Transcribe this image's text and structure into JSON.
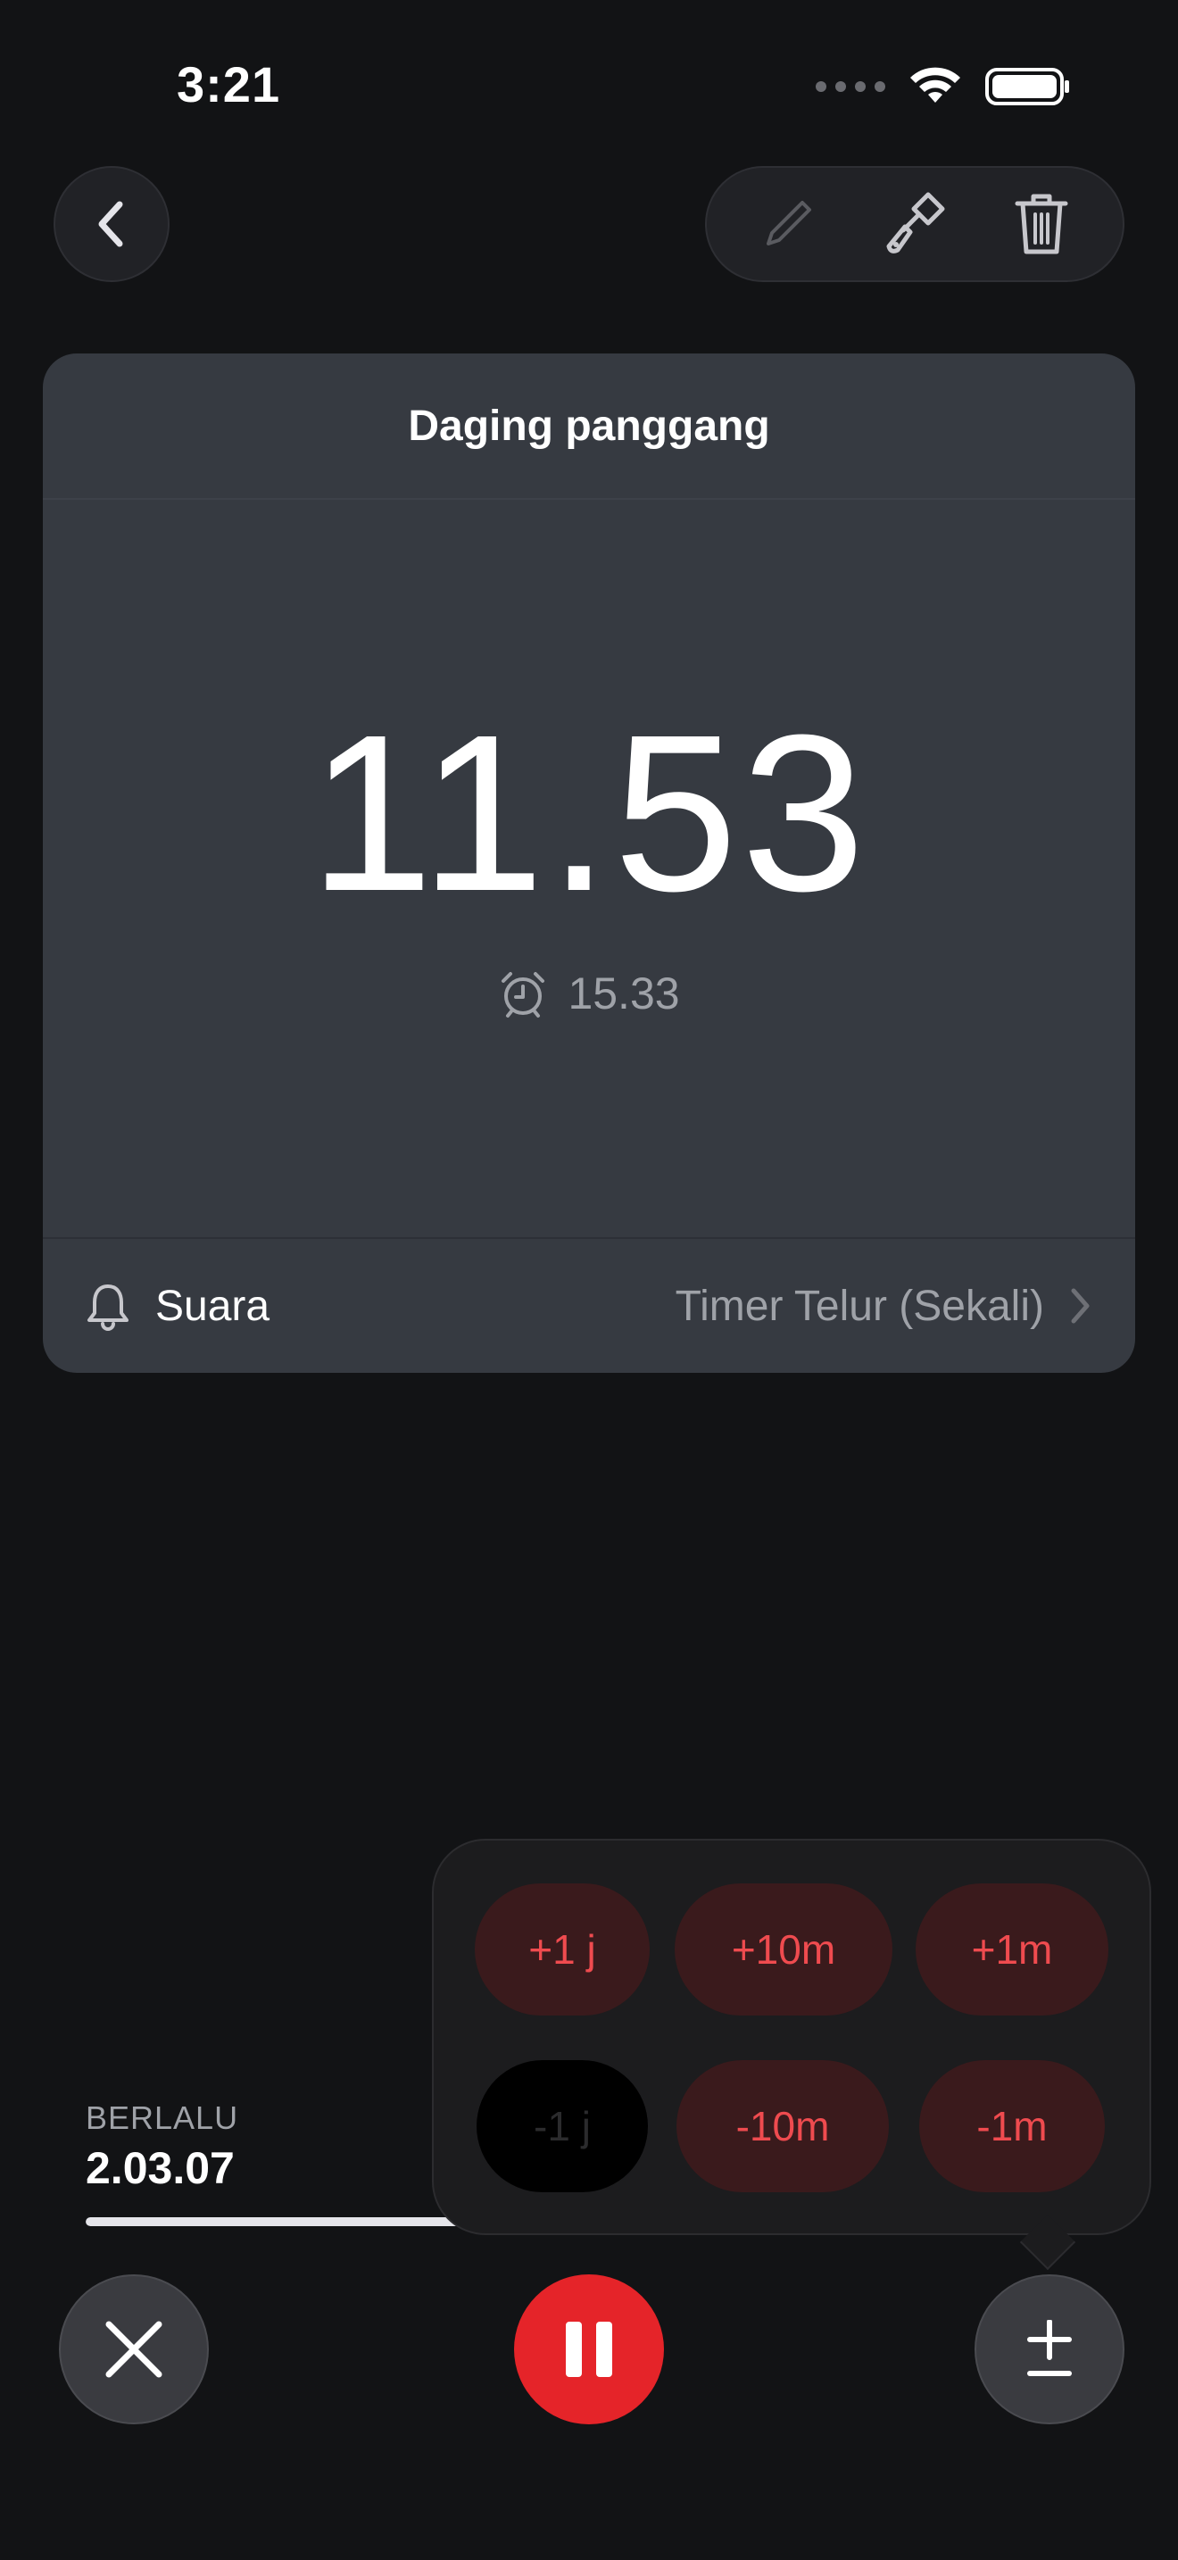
{
  "status_bar": {
    "time": "3:21",
    "icons": [
      "cellular-signal-icon",
      "wifi-icon",
      "battery-icon"
    ]
  },
  "nav": {
    "back_icon": "chevron-left-icon",
    "actions": [
      "pencil-icon",
      "paintbrush-icon",
      "trash-icon"
    ]
  },
  "timer": {
    "name": "Daging panggang",
    "remaining": "11.53",
    "end_time": "15.33",
    "end_icon": "alarm-clock-icon"
  },
  "sound": {
    "label": "Suara",
    "value": "Timer Telur (Sekali)",
    "icon": "bell-icon"
  },
  "elapsed": {
    "label": "BERLALU",
    "value": "2.03.07",
    "progress_fraction": 0.38
  },
  "adjust": {
    "buttons": [
      {
        "label": "+1 j",
        "enabled": true
      },
      {
        "label": "+10m",
        "enabled": true
      },
      {
        "label": "+1m",
        "enabled": true
      },
      {
        "label": "-1 j",
        "enabled": false
      },
      {
        "label": "-10m",
        "enabled": true
      },
      {
        "label": "-1m",
        "enabled": true
      }
    ]
  },
  "controls": {
    "cancel_icon": "close-icon",
    "pause_icon": "pause-icon",
    "adjust_icon": "plus-minus-icon"
  },
  "colors": {
    "background": "#121315",
    "card": "#363a41",
    "accent_red": "#e52429",
    "adjust_text": "#ef4b4f",
    "adjust_bg": "#3a1a1c"
  }
}
